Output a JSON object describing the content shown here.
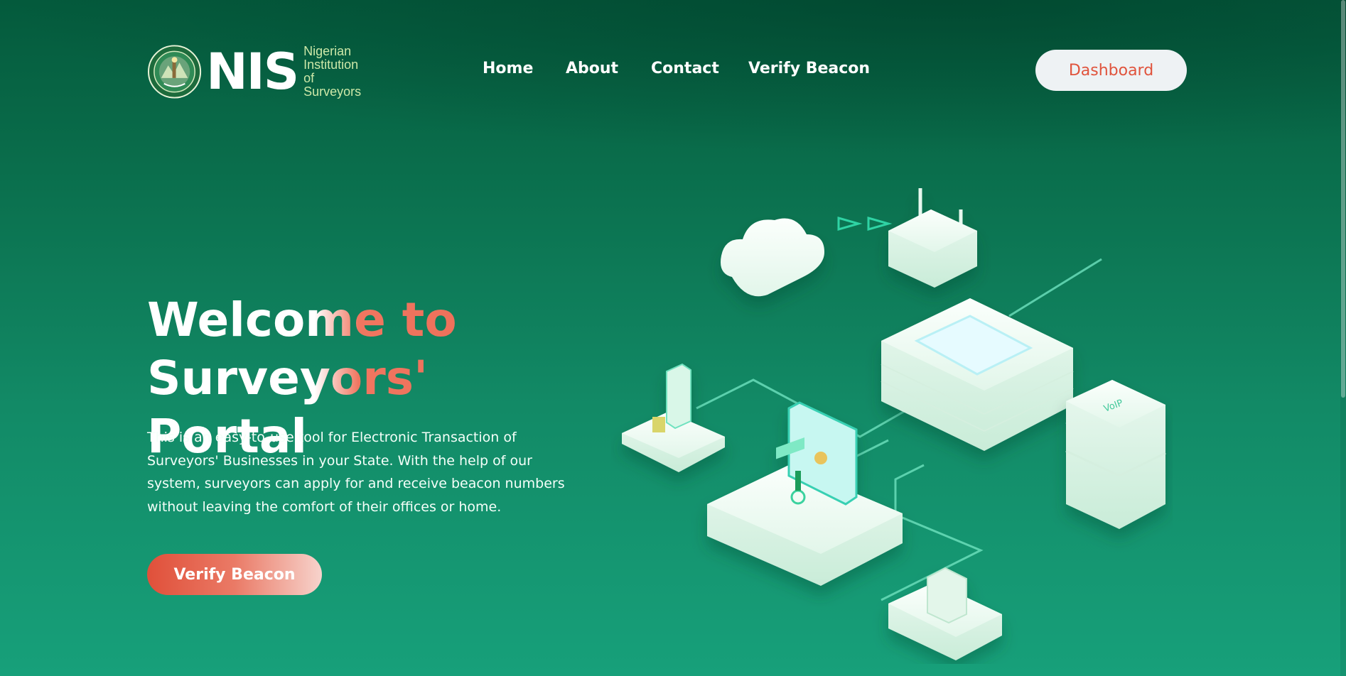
{
  "header": {
    "logo": {
      "abbr": "NIS",
      "name_lines": [
        "Nigerian",
        "Institution",
        "of Surveyors"
      ],
      "seal_text": "NIGERIAN INSTITUTION OF SURVEYORS 1934",
      "seal_icon": "nis-seal-icon"
    },
    "nav": {
      "home": "Home",
      "about": "About",
      "contact": "Contact",
      "verify_beacon": "Verify Beacon"
    },
    "dashboard_label": "Dashboard"
  },
  "hero": {
    "title_line1": "Welcome to",
    "title_line2": "Surveyors' Portal",
    "description": "This is an easy-to-use tool for Electronic Transaction of Surveyors' Businesses in your State. With the help of our system, surveyors can apply for and receive beacon numbers without leaving the comfort of their offices or home.",
    "cta_label": "Verify Beacon"
  },
  "illustration": {
    "name": "network-illustration",
    "voip_label": "VoIP"
  },
  "colors": {
    "bg_top": "#045a3c",
    "bg_bottom": "#17a07a",
    "accent": "#e0533c",
    "button_light": "#eef2f4",
    "logo_text": "#cde8a8"
  }
}
